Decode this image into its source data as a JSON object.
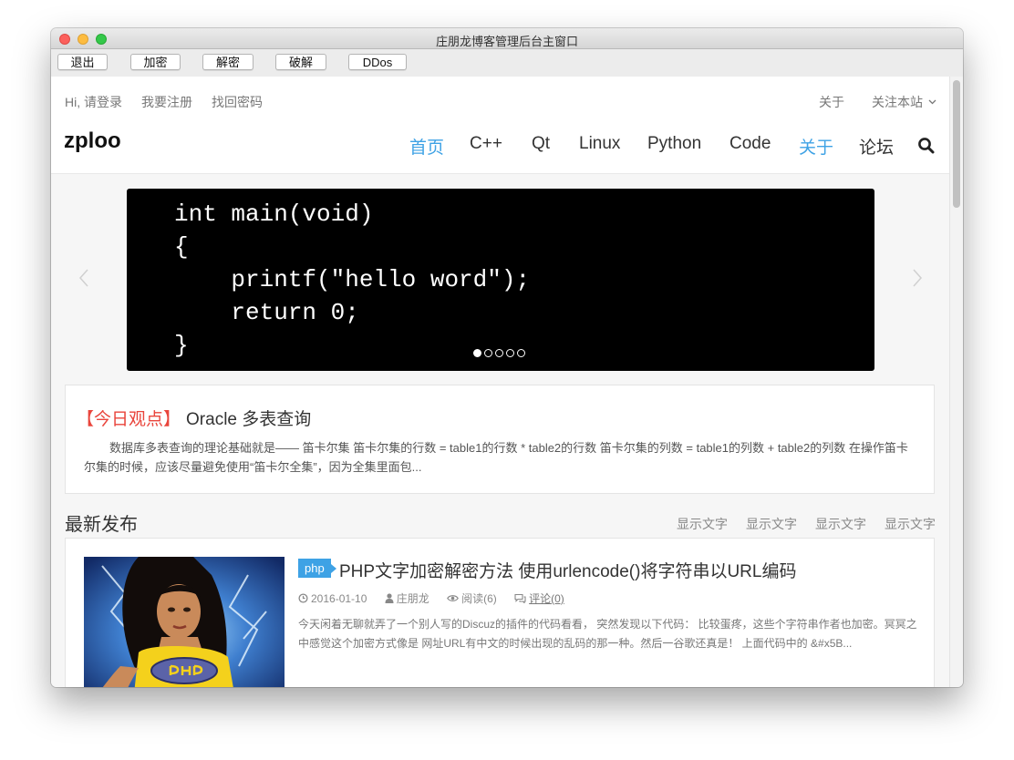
{
  "window": {
    "title": "庄朋龙博客管理后台主窗口"
  },
  "toolbar": {
    "buttons": [
      "退出",
      "加密",
      "解密",
      "破解",
      "DDos"
    ]
  },
  "header": {
    "greeting": "Hi, 请登录",
    "register": "我要注册",
    "find_password": "找回密码",
    "about": "关于",
    "follow": "关注本站",
    "logo": "zploo",
    "nav": [
      "首页",
      "C++",
      "Qt",
      "Linux",
      "Python",
      "Code",
      "关于",
      "论坛"
    ],
    "accent_color": "#3ea2e5"
  },
  "carousel": {
    "code_lines": [
      "int main(void)",
      "{",
      "    printf(\"hello word\");",
      "    return 0;",
      "}"
    ],
    "slide_count": 5,
    "active_slide": 1
  },
  "feature": {
    "tag": "【今日观点】",
    "title": "Oracle 多表查询",
    "body": "数据库多表查询的理论基础就是—— 笛卡尔集 笛卡尔集的行数 = table1的行数 * table2的行数 笛卡尔集的列数 = table1的列数 + table2的列数 在操作笛卡尔集的时候，应该尽量避免使用“笛卡尔全集”，因为全集里面包..."
  },
  "latest": {
    "title": "最新发布",
    "links": [
      "显示文字",
      "显示文字",
      "显示文字",
      "显示文字"
    ]
  },
  "article": {
    "badge": "php",
    "title": "PHP文字加密解密方法 使用urlencode()将字符串以URL编码",
    "date": "2016-01-10",
    "author": "庄朋龙",
    "reads": "阅读(6)",
    "comments": "评论(0)",
    "excerpt": "今天闲着无聊就弄了一个别人写的Discuz的插件的代码看看， 突然发现以下代码： 比较蛋疼，这些个字符串作者也加密。冥冥之中感觉这个加密方式像是 网址URL有中文的时候出现的乱码的那一种。然后一谷歌还真是！ 上面代码中的 &#x5B..."
  }
}
